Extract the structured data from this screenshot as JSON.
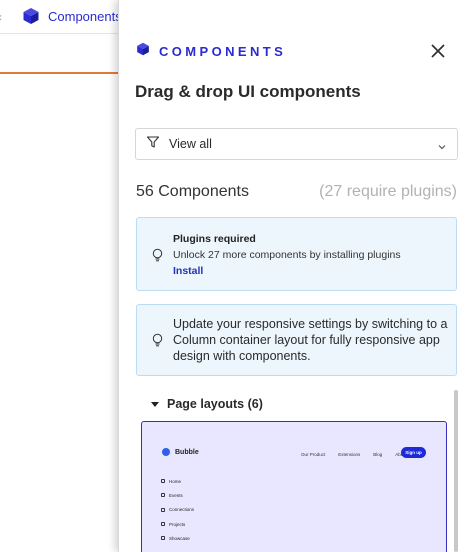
{
  "background": {
    "tab_label": "Components",
    "left_arrow": "‹"
  },
  "drawer": {
    "title": "COMPONENTS",
    "subtitle": "Drag & drop UI components",
    "filter": {
      "label": "View all"
    },
    "count": {
      "main": "56 Components",
      "sub": "(27 require plugins)"
    },
    "plugin_notice": {
      "title": "Plugins required",
      "text": "Unlock 27 more components by installing plugins",
      "link": "Install"
    },
    "responsive_notice": {
      "text": "Update your responsive settings by switching to a Column container layout for fully responsive app design with components."
    },
    "section": {
      "label": "Page layouts (6)"
    },
    "preview": {
      "brand": "Bubble",
      "nav": [
        "Our Product",
        "Extensions",
        "Blog",
        "About"
      ],
      "cta": "Sign up",
      "sidebar": [
        "Home",
        "Events",
        "Connections",
        "Projects",
        "Showcase"
      ]
    }
  },
  "colors": {
    "accent": "#2b2bd1",
    "info_bg": "#eef6fd",
    "info_border": "#bcdcf3",
    "card_bg": "#e9e7ff",
    "card_border": "#3a2fb8"
  }
}
